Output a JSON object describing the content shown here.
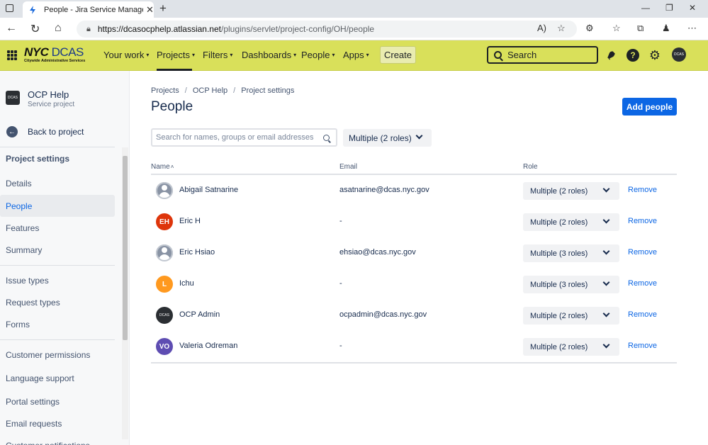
{
  "browser": {
    "tab_title": "People - Jira Service Management",
    "url_host": "https://dcasocphelp.atlassian.net",
    "url_path": "/plugins/servlet/project-config/OH/people"
  },
  "header": {
    "logo_main": "NYC",
    "logo_accent": "DCAS",
    "logo_sub": "Citywide Administrative Services",
    "nav": [
      "Your work",
      "Projects",
      "Filters",
      "Dashboards",
      "People",
      "Apps"
    ],
    "create_label": "Create",
    "search_label": "Search",
    "help_label": "?",
    "colors": {
      "bar": "#d9e05a"
    }
  },
  "sidebar": {
    "project_name": "OCP Help",
    "project_type": "Service project",
    "back_label": "Back to project",
    "section_title": "Project settings",
    "items": [
      "Details",
      "People",
      "Features",
      "Summary",
      "Issue types",
      "Request types",
      "Forms",
      "Customer permissions",
      "Language support",
      "Portal settings",
      "Email requests",
      "Customer notifications"
    ],
    "selected": "People"
  },
  "main": {
    "breadcrumbs": [
      "Projects",
      "OCP Help",
      "Project settings"
    ],
    "title": "People",
    "add_button": "Add people",
    "search_placeholder": "Search for names, groups or email addresses",
    "role_filter": "Multiple (2 roles)",
    "columns": {
      "name": "Name",
      "sort_indicator": "˄",
      "email": "Email",
      "role": "Role"
    },
    "remove_label": "Remove",
    "rows": [
      {
        "name": "Abigail Satnarine",
        "email": "asatnarine@dcas.nyc.gov",
        "role": "Multiple (2 roles)",
        "avatar": "default",
        "initials": "",
        "color": "#8993a4"
      },
      {
        "name": "Eric H",
        "email": "-",
        "role": "Multiple (2 roles)",
        "avatar": "initials",
        "initials": "EH",
        "color": "#de350b"
      },
      {
        "name": "Eric Hsiao",
        "email": "ehsiao@dcas.nyc.gov",
        "role": "Multiple (3 roles)",
        "avatar": "default",
        "initials": "",
        "color": "#8993a4"
      },
      {
        "name": "Ichu",
        "email": "-",
        "role": "Multiple (3 roles)",
        "avatar": "initials",
        "initials": "L",
        "color": "#ff991f"
      },
      {
        "name": "OCP Admin",
        "email": "ocpadmin@dcas.nyc.gov",
        "role": "Multiple (2 roles)",
        "avatar": "logo",
        "initials": "DCAS",
        "color": "#2b2f33"
      },
      {
        "name": "Valeria Odreman",
        "email": "-",
        "role": "Multiple (2 roles)",
        "avatar": "initials",
        "initials": "VO",
        "color": "#5e4db2"
      }
    ]
  }
}
